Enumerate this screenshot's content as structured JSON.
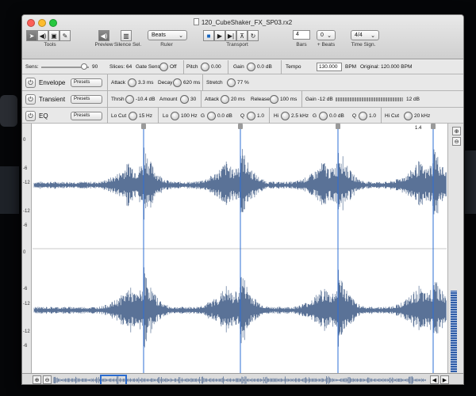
{
  "window": {
    "title": "120_CubeShaker_FX_SP03.rx2"
  },
  "toolbar": {
    "tools_label": "Tools",
    "preview_label": "Preview",
    "silence_label": "Silence Sel.",
    "ruler_label": "Ruler",
    "ruler_value": "Beats",
    "transport_label": "Transport",
    "bars_label": "Bars",
    "bars_value": "4",
    "beats_label": "+ Beats",
    "beats_value": "0",
    "timesig_label": "Time Sign.",
    "timesig_value": "4/4"
  },
  "row1": {
    "sens_label": "Sens:",
    "sens_value": "90",
    "sens_level": 0.9,
    "slices": "Slices: 64",
    "gate_label": "Gate Sens",
    "gate_value": "Off",
    "pitch_label": "Pitch",
    "pitch_value": "0.00",
    "gain_label": "Gain",
    "gain_value": "0.0 dB",
    "tempo_label": "Tempo",
    "tempo_value": "130.000",
    "tempo_unit": "BPM",
    "original": "Original: 120.000 BPM"
  },
  "envelope": {
    "name": "Envelope",
    "presets": "Presets",
    "attack_label": "Attack",
    "attack_value": "3.3 ms",
    "decay_label": "Decay",
    "decay_value": "620 ms",
    "stretch_label": "Stretch",
    "stretch_value": "77 %"
  },
  "transient": {
    "name": "Transient",
    "presets": "Presets",
    "thrsh_label": "Thrsh",
    "thrsh_value": "-10.4 dB",
    "amount_label": "Amount",
    "amount_value": "30",
    "attack_label": "Attack",
    "attack_value": "20 ms",
    "release_label": "Release",
    "release_value": "100 ms",
    "gain_label": "Gain -12 dB",
    "gain_max": "12 dB"
  },
  "eq": {
    "name": "EQ",
    "presets": "Presets",
    "locut_label": "Lo Cut",
    "locut_value": "15 Hz",
    "lo_label": "Lo",
    "lo_value": "100 Hz",
    "lo_g_label": "G",
    "lo_g_value": "0.0 dB",
    "lo_q_label": "Q",
    "lo_q_value": "1.0",
    "hi_label": "Hi",
    "hi_value": "2.5 kHz",
    "hi_g_label": "G",
    "hi_g_value": "0.0 dB",
    "hi_q_label": "Q",
    "hi_q_value": "1.0",
    "hicut_label": "Hi Cut",
    "hicut_value": "20 kHz"
  },
  "ruler": {
    "marker": "1.4"
  },
  "scale": {
    "zero": "0",
    "labels": [
      "-6",
      "-12",
      "-12",
      "-6",
      "0",
      "-6",
      "-12",
      "-12",
      "-6"
    ]
  },
  "colors": {
    "wave": "#5a7297",
    "marker": "#2d6fd6"
  }
}
